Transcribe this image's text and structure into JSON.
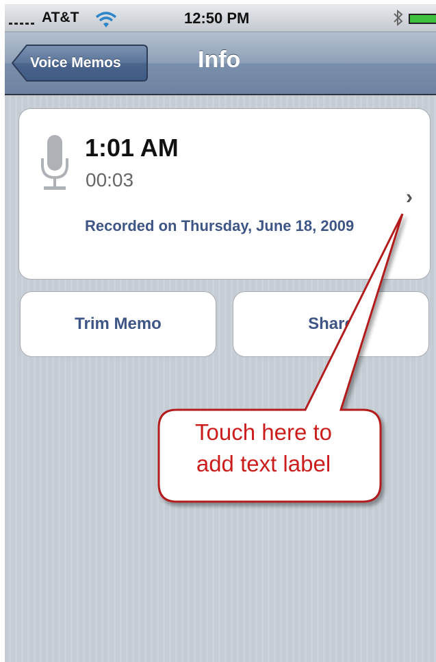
{
  "status_bar": {
    "carrier": "AT&T",
    "time": "12:50 PM"
  },
  "nav": {
    "back_label": "Voice Memos",
    "title": "Info"
  },
  "memo": {
    "time": "1:01 AM",
    "duration": "00:03",
    "recorded": "Recorded on Thursday, June 18, 2009"
  },
  "buttons": {
    "trim": "Trim Memo",
    "share": "Share"
  },
  "callout": {
    "line1": "Touch here to",
    "line2": "add text label"
  },
  "colors": {
    "link_blue": "#3e5585",
    "callout_red": "#cc1d1d",
    "battery_green": "#3fc03f"
  }
}
